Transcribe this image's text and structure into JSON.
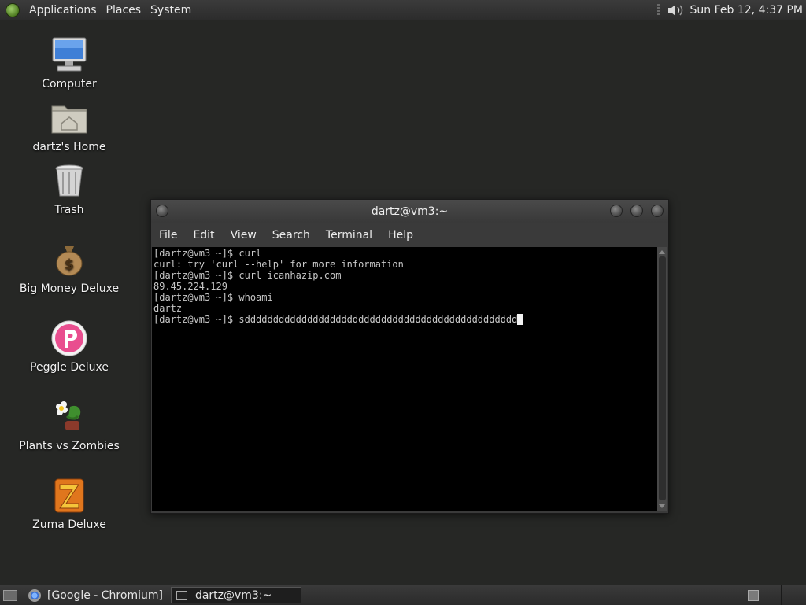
{
  "top_panel": {
    "menus": [
      "Applications",
      "Places",
      "System"
    ],
    "clock": "Sun Feb 12,  4:37 PM"
  },
  "desktop_icons": [
    {
      "label": "Computer",
      "icon": "computer-icon"
    },
    {
      "label": "dartz's Home",
      "icon": "home-folder-icon"
    },
    {
      "label": "Trash",
      "icon": "trash-icon"
    },
    {
      "label": "Big Money Deluxe",
      "icon": "money-bag-icon"
    },
    {
      "label": "Peggle Deluxe",
      "icon": "peggle-icon"
    },
    {
      "label": "Plants vs Zombies",
      "icon": "plants-vs-zombies-icon"
    },
    {
      "label": "Zuma Deluxe",
      "icon": "zuma-icon"
    }
  ],
  "terminal": {
    "title": "dartz@vm3:~",
    "menu": [
      "File",
      "Edit",
      "View",
      "Search",
      "Terminal",
      "Help"
    ],
    "lines": [
      "[dartz@vm3 ~]$ curl",
      "curl: try 'curl --help' for more information",
      "[dartz@vm3 ~]$ curl icanhazip.com",
      "89.45.224.129",
      "[dartz@vm3 ~]$ whoami",
      "dartz",
      "[dartz@vm3 ~]$ sdddddddddddddddddddddddddddddddddddddddddddddddd"
    ]
  },
  "taskbar": {
    "tasks": [
      {
        "label": "[Google - Chromium]",
        "icon": "chromium-icon",
        "active": false
      },
      {
        "label": "dartz@vm3:~",
        "icon": "terminal-icon",
        "active": true
      }
    ]
  }
}
